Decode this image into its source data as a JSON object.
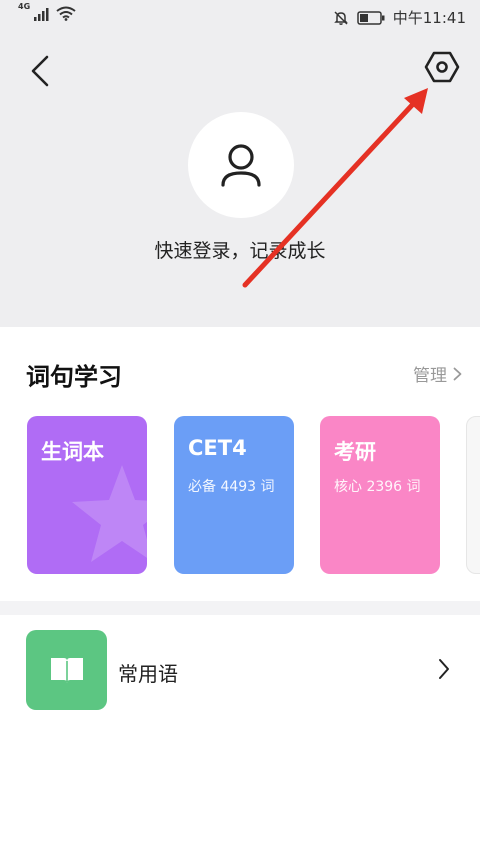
{
  "status_bar": {
    "network": "4G",
    "time": "中午11:41",
    "icons": [
      "signal-icon",
      "wifi-icon",
      "mute-icon",
      "battery-icon"
    ]
  },
  "nav": {
    "back_icon": "chevron-left-icon",
    "settings_icon": "settings-hexagon-icon"
  },
  "profile": {
    "avatar_icon": "user-icon",
    "login_prompt": "快速登录，记录成长"
  },
  "vocab": {
    "title": "词句学习",
    "manage_label": "管理",
    "cards": [
      {
        "title": "生词本",
        "subtitle": "",
        "color": "#b06cf5"
      },
      {
        "title": "CET4",
        "subtitle": "必备 4493 词",
        "color": "#6b9ef6"
      },
      {
        "title": "考研",
        "subtitle": "核心 2396 词",
        "color": "#fa86c6"
      }
    ]
  },
  "phrases": {
    "label": "常用语",
    "icon": "book-icon",
    "icon_color": "#5cc682"
  },
  "annotation": {
    "arrow_color": "#e53124"
  }
}
